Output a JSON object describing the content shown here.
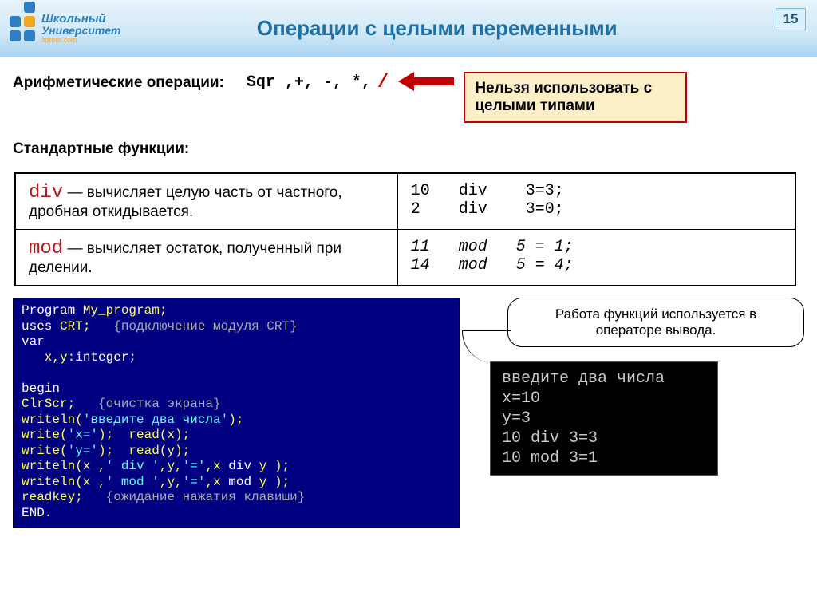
{
  "header": {
    "logo_line1": "Школьный",
    "logo_line2": "Университет",
    "logo_sub": "itdrom.com",
    "title": "Операции с целыми переменными",
    "page": "15"
  },
  "arith": {
    "label": "Арифметические операции:",
    "ops": "Sqr ,+, -,  *,",
    "slash": "/"
  },
  "callout": "Нельзя использовать с целыми типами",
  "stdfunc_label": "Стандартные функции:",
  "table": {
    "div": {
      "kw": "div",
      "desc": " — вычисляет целую часть от частного, дробная откидывается.",
      "ex": "10   div    3=3;\n2    div    3=0;"
    },
    "mod": {
      "kw": "mod",
      "desc": " — вычисляет остаток, полученный при делении.",
      "ex": "11   mod   5 = 1;\n14   mod   5 = 4;"
    }
  },
  "code": {
    "l1a": "Program ",
    "l1b": "My_program;",
    "l2a": "uses ",
    "l2b": "CRT;   ",
    "l2c": "{подключение модуля CRT}",
    "l3": "var",
    "l4a": "   x,y:",
    "l4b": "integer;",
    "l5": "",
    "l6": "begin",
    "l7a": "ClrScr;   ",
    "l7b": "{очистка экрана}",
    "l8a": "writeln(",
    "l8b": "'введите два числа'",
    "l8c": ");",
    "l9a": "write(",
    "l9b": "'x='",
    "l9c": ");  read(x);",
    "l10a": "write(",
    "l10b": "'y='",
    "l10c": ");  read(y);",
    "l11a": "writeln(x ,",
    "l11b": "' div '",
    "l11c": ",y,",
    "l11d": "'='",
    "l11e": ",x ",
    "l11f": "div",
    "l11g": " y );",
    "l12a": "writeln(x ,",
    "l12b": "' mod '",
    "l12c": ",y,",
    "l12d": "'='",
    "l12e": ",x ",
    "l12f": "mod",
    "l12g": " y );",
    "l13a": "readkey;   ",
    "l13b": "{ожидание нажатия клавиши}",
    "l14": "END."
  },
  "speech": "Работа функций используется в операторе вывода.",
  "console": "введите два числа\nx=10\ny=3\n10 div 3=3\n10 mod 3=1"
}
